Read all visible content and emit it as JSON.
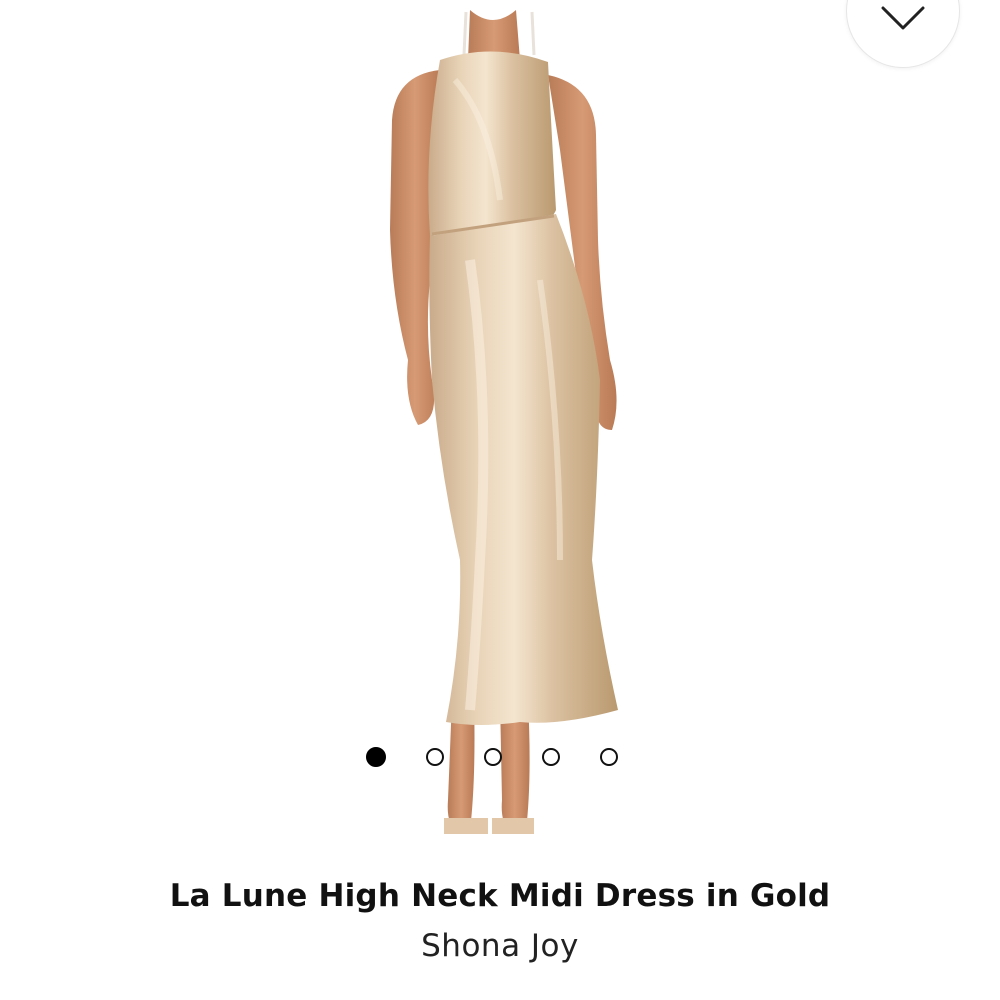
{
  "product": {
    "title": "La Lune High Neck Midi Dress in Gold",
    "brand": "Shona Joy",
    "image_description_icon": "dress-photo",
    "dress_color": "#d9bf9f",
    "skin_color": "#c98f6a"
  },
  "gallery": {
    "image_count": 5,
    "active_index": 0
  },
  "controls": {
    "collapse_icon": "chevron-down-icon"
  }
}
